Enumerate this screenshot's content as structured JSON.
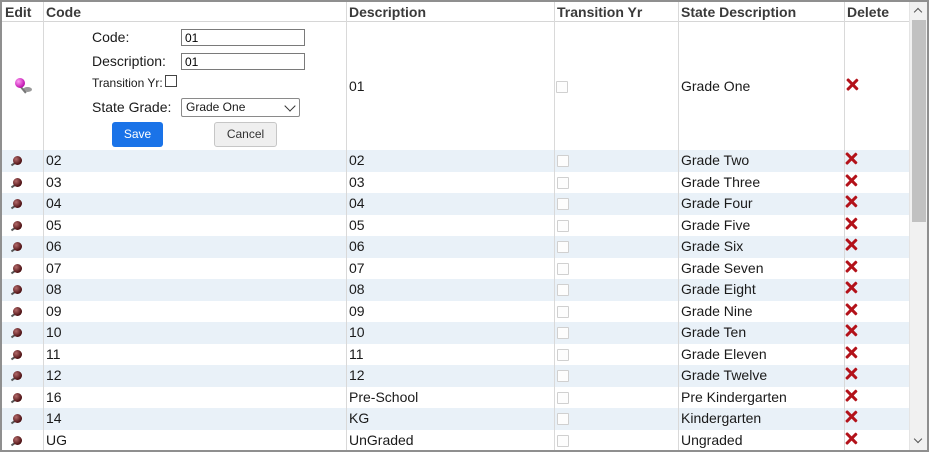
{
  "columns": {
    "edit": "Edit",
    "code": "Code",
    "description": "Description",
    "transition_yr": "Transition Yr",
    "state_description": "State Description",
    "delete": "Delete"
  },
  "edit_form": {
    "code_label": "Code:",
    "code_value": "01",
    "description_label": "Description:",
    "description_value": "01",
    "transition_label": "Transition Yr:",
    "transition_checked": false,
    "state_grade_label": "State Grade:",
    "state_grade_value": "Grade One",
    "save_label": "Save",
    "cancel_label": "Cancel",
    "row_description": "01",
    "row_state_description": "Grade One"
  },
  "rows": [
    {
      "code": "02",
      "description": "02",
      "state": "Grade Two"
    },
    {
      "code": "03",
      "description": "03",
      "state": "Grade Three"
    },
    {
      "code": "04",
      "description": "04",
      "state": "Grade Four"
    },
    {
      "code": "05",
      "description": "05",
      "state": "Grade Five"
    },
    {
      "code": "06",
      "description": "06",
      "state": "Grade Six"
    },
    {
      "code": "07",
      "description": "07",
      "state": "Grade Seven"
    },
    {
      "code": "08",
      "description": "08",
      "state": "Grade Eight"
    },
    {
      "code": "09",
      "description": "09",
      "state": "Grade Nine"
    },
    {
      "code": "10",
      "description": "10",
      "state": "Grade Ten"
    },
    {
      "code": "11",
      "description": "11",
      "state": "Grade Eleven"
    },
    {
      "code": "12",
      "description": "12",
      "state": "Grade Twelve"
    },
    {
      "code": "16",
      "description": "Pre-School",
      "state": "Pre Kindergarten"
    },
    {
      "code": "14",
      "description": "KG",
      "state": "Kindergarten"
    },
    {
      "code": "UG",
      "description": "UnGraded",
      "state": "Ungraded"
    }
  ],
  "icons": {
    "edit": "pushpin-icon",
    "row_edit": "pin-icon",
    "delete": "delete-x-icon"
  },
  "colors": {
    "save_button": "#1a73e8",
    "alt_row": "#e9f1f8",
    "delete_icon": "#b3121a"
  }
}
